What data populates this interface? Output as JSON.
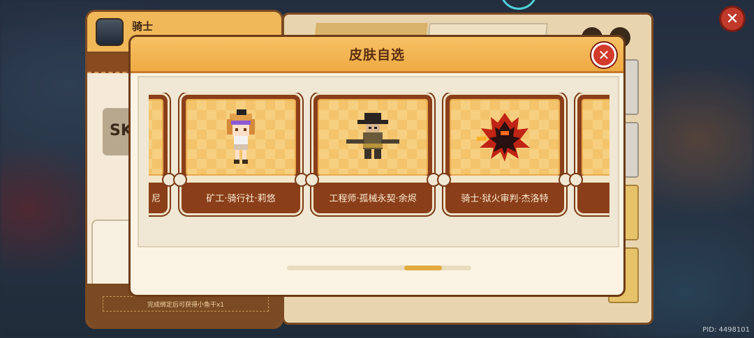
{
  "background": {
    "hero_name": "骑士",
    "bind_hint": "完成绑定后可获得小鱼干x1",
    "pid": "PID: 4498101",
    "sk_text": "SK"
  },
  "modal": {
    "title": "皮肤自选",
    "close_glyph": "✕",
    "cards": [
      {
        "label": "尼",
        "partial": true
      },
      {
        "label": "矿工·骑行社·莉悠",
        "icon": "girl-sprite-icon"
      },
      {
        "label": "工程师·孤械永契·余烬",
        "icon": "cowboy-sprite-icon"
      },
      {
        "label": "骑士·狱火审判·杰洛特",
        "icon": "flame-knight-sprite-icon"
      },
      {
        "label": "",
        "partial": true
      }
    ],
    "scroll_position": 0.8
  },
  "outer_close_glyph": "✕",
  "colors": {
    "header": "#efaa44",
    "card_bg": "#8a3f1a",
    "close_red": "#d23a2c"
  }
}
